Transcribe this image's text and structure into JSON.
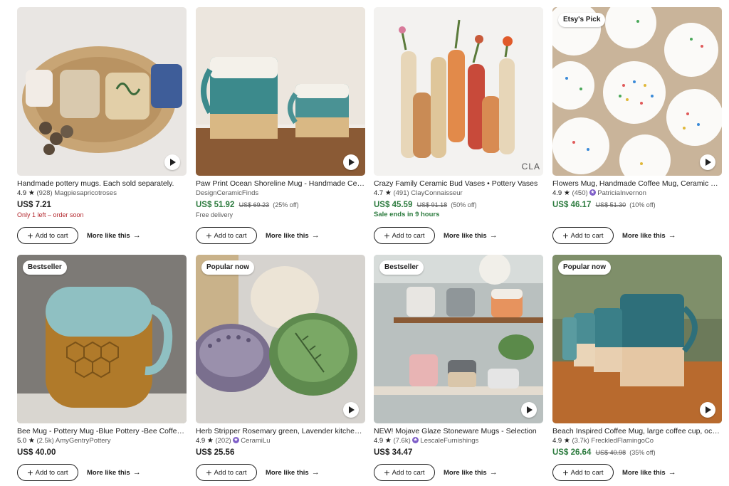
{
  "products": [
    {
      "title": "Handmade pottery mugs. Each sold separately.",
      "rating": "4.9",
      "reviews": "(928)",
      "shop": "Magpiesapricotroses",
      "star_seller": false,
      "price": "US$ 7.21",
      "original_price": "",
      "discount": "",
      "note": "Only 1 left – order soon",
      "badge": "",
      "cart_label": "Add to cart",
      "more_label": "More like this"
    },
    {
      "title": "Paw Print Ocean Shoreline Mug - Handmade Ceramic",
      "rating": "",
      "reviews": "",
      "shop": "DesignCeramicFinds",
      "star_seller": false,
      "price": "US$ 51.92",
      "original_price": "US$ 69.23",
      "discount": "(25% off)",
      "note": "Free delivery",
      "badge": "",
      "cart_label": "Add to cart",
      "more_label": "More like this"
    },
    {
      "title": "Crazy Family Ceramic Bud Vases • Pottery Vases",
      "rating": "4.7",
      "reviews": "(491)",
      "shop": "ClayConnaisseur",
      "star_seller": false,
      "price": "US$ 45.59",
      "original_price": "US$ 91.18",
      "discount": "(50% off)",
      "note": "Sale ends in 9 hours",
      "badge": "",
      "cart_label": "Add to cart",
      "more_label": "More like this"
    },
    {
      "title": "Flowers Mug, Handmade Coffee Mug, Ceramic Mug",
      "rating": "4.9",
      "reviews": "(450)",
      "shop": "PatriciaInvernon",
      "star_seller": true,
      "price": "US$ 46.17",
      "original_price": "US$ 51.30",
      "discount": "(10% off)",
      "note": "",
      "badge": "Etsy's Pick",
      "cart_label": "Add to cart",
      "more_label": "More like this"
    },
    {
      "title": "Bee Mug - Pottery Mug -Blue Pottery -Bee Coffee Mug",
      "rating": "5.0",
      "reviews": "(2.5k)",
      "shop": "AmyGentryPottery",
      "star_seller": false,
      "price": "US$ 40.00",
      "original_price": "",
      "discount": "",
      "note": "",
      "badge": "Bestseller",
      "cart_label": "Add to cart",
      "more_label": "More like this"
    },
    {
      "title": "Herb Stripper Rosemary green, Lavender kitchen tool",
      "rating": "4.9",
      "reviews": "(202)",
      "shop": "CeramiLu",
      "star_seller": true,
      "price": "US$ 25.56",
      "original_price": "",
      "discount": "",
      "note": "",
      "badge": "Popular now",
      "cart_label": "Add to cart",
      "more_label": "More like this"
    },
    {
      "title": "NEW! Mojave Glaze Stoneware Mugs - Selection",
      "rating": "4.9",
      "reviews": "(7.6k)",
      "shop": "LescaleFurnishings",
      "star_seller": true,
      "price": "US$ 34.47",
      "original_price": "",
      "discount": "",
      "note": "",
      "badge": "Bestseller",
      "cart_label": "Add to cart",
      "more_label": "More like this"
    },
    {
      "title": "Beach Inspired Coffee Mug, large coffee cup, ocean",
      "rating": "4.9",
      "reviews": "(3.7k)",
      "shop": "FreckledFlamingoCo",
      "star_seller": false,
      "price": "US$ 26.64",
      "original_price": "US$ 40.98",
      "discount": "(35% off)",
      "note": "",
      "badge": "Popular now",
      "cart_label": "Add to cart",
      "more_label": "More like this"
    }
  ],
  "image_watermark": "CLA",
  "colors": {
    "sale_price": "#2c7b3e",
    "urgent_note": "#b3272d",
    "star_seller": "#7f5fc8"
  }
}
